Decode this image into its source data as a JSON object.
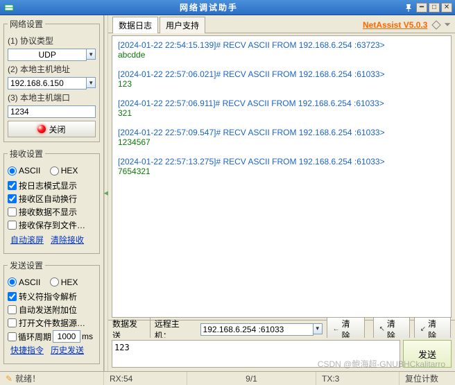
{
  "window": {
    "title": "网络调试助手"
  },
  "sidebar": {
    "net": {
      "legend": "网络设置",
      "proto_label": "(1) 协议类型",
      "proto_value": "UDP",
      "host_label": "(2) 本地主机地址",
      "host_value": "192.168.6.150",
      "port_label": "(3) 本地主机端口",
      "port_value": "1234",
      "close_label": "关闭"
    },
    "recv": {
      "legend": "接收设置",
      "ascii": "ASCII",
      "hex": "HEX",
      "opt1": "按日志模式显示",
      "opt2": "接收区自动换行",
      "opt3": "接收数据不显示",
      "opt4": "接收保存到文件…",
      "link1": "自动滚屏",
      "link2": "清除接收"
    },
    "send": {
      "legend": "发送设置",
      "ascii": "ASCII",
      "hex": "HEX",
      "opt1": "转义符指令解析",
      "opt2": "自动发送附加位",
      "opt3": "打开文件数据源…",
      "loop_label": "循环周期",
      "loop_value": "1000",
      "loop_unit": "ms",
      "link1": "快捷指令",
      "link2": "历史发送"
    }
  },
  "tabs": {
    "t1": "数据日志",
    "t2": "用户支持"
  },
  "version": "NetAssist V5.0.3",
  "log": [
    {
      "meta": "[2024-01-22 22:54:15.139]# RECV ASCII FROM 192.168.6.254 :63723>",
      "data": "abcdde"
    },
    {
      "meta": "[2024-01-22 22:57:06.021]# RECV ASCII FROM 192.168.6.254 :61033>",
      "data": "123"
    },
    {
      "meta": "[2024-01-22 22:57:06.911]# RECV ASCII FROM 192.168.6.254 :61033>",
      "data": "321"
    },
    {
      "meta": "[2024-01-22 22:57:09.547]# RECV ASCII FROM 192.168.6.254 :61033>",
      "data": "1234567"
    },
    {
      "meta": "[2024-01-22 22:57:13.275]# RECV ASCII FROM 192.168.6.254 :61033>",
      "data": "7654321"
    }
  ],
  "sendbar": {
    "data_label": "数据发送",
    "remote_label": "远程主机：",
    "remote_value": "192.168.6.254 :61033",
    "clear1": "清除",
    "clear2": "清除",
    "clear3": "清除",
    "input_value": "123",
    "send_btn": "发送"
  },
  "status": {
    "ready": "就绪！",
    "rx": "RX:54",
    "mid": "9/1",
    "tx": "TX:3",
    "reset": "复位计数"
  },
  "watermark": "CSDN @鲍海超-GNUBHCkalitarro"
}
